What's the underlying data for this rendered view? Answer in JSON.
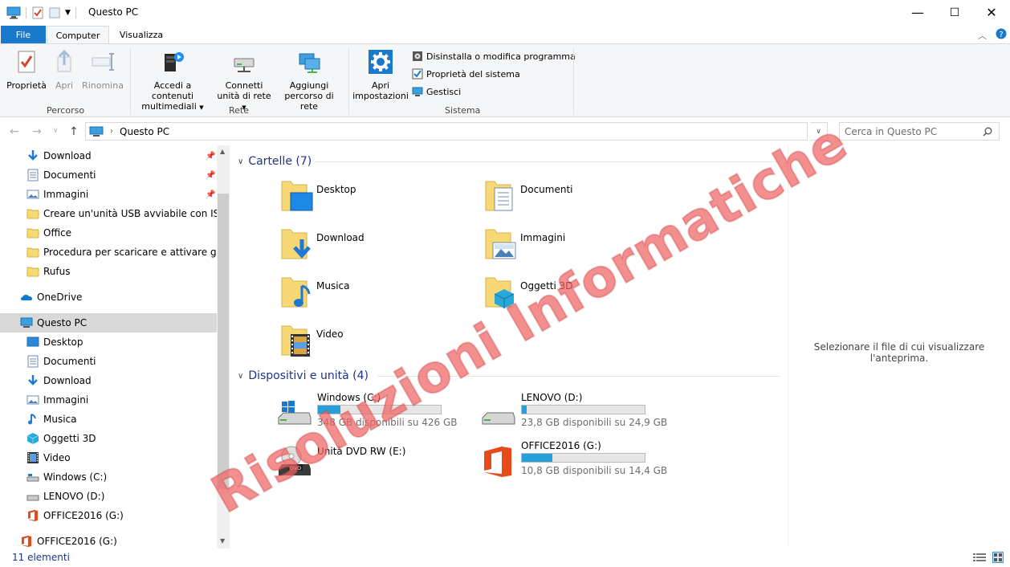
{
  "window": {
    "title": "Questo PC",
    "minimize": "—",
    "maximize": "☐",
    "close": "✕"
  },
  "ribbon_tabs": {
    "file": "File",
    "computer": "Computer",
    "view": "Visualizza"
  },
  "ribbon": {
    "percorso": {
      "label": "Percorso",
      "properties": "Proprietà",
      "open": "Apri",
      "rename": "Rinomina"
    },
    "rete": {
      "label": "Rete",
      "media_line1": "Accedi a contenuti",
      "media_line2": "multimediali",
      "map_line1": "Connetti",
      "map_line2": "unità di rete",
      "add_line1": "Aggiungi",
      "add_line2": "percorso di rete"
    },
    "sistema": {
      "label": "Sistema",
      "settings_line1": "Apri",
      "settings_line2": "impostazioni",
      "uninstall": "Disinstalla o modifica programma",
      "system_properties": "Proprietà del sistema",
      "manage": "Gestisci"
    }
  },
  "address": {
    "path": "Questo PC",
    "search_placeholder": "Cerca in Questo PC"
  },
  "nav_pane": {
    "quick_access": [
      {
        "label": "Download",
        "icon": "download-icon",
        "pinned": true
      },
      {
        "label": "Documenti",
        "icon": "documents-icon",
        "pinned": true
      },
      {
        "label": "Immagini",
        "icon": "pictures-icon",
        "pinned": true
      },
      {
        "label": "Creare un'unità USB avviabile con ISO to",
        "icon": "folder-icon",
        "pinned": false
      },
      {
        "label": "Office",
        "icon": "folder-icon",
        "pinned": false
      },
      {
        "label": "Procedura per scaricare e attivare gratuita",
        "icon": "folder-icon",
        "pinned": false
      },
      {
        "label": "Rufus",
        "icon": "folder-icon",
        "pinned": false
      }
    ],
    "onedrive": "OneDrive",
    "this_pc": "Questo PC",
    "this_pc_items": [
      {
        "label": "Desktop",
        "icon": "desktop-icon"
      },
      {
        "label": "Documenti",
        "icon": "documents-icon"
      },
      {
        "label": "Download",
        "icon": "download-icon"
      },
      {
        "label": "Immagini",
        "icon": "pictures-icon"
      },
      {
        "label": "Musica",
        "icon": "music-icon"
      },
      {
        "label": "Oggetti 3D",
        "icon": "3d-objects-icon"
      },
      {
        "label": "Video",
        "icon": "video-icon"
      },
      {
        "label": "Windows (C:)",
        "icon": "drive-icon"
      },
      {
        "label": "LENOVO (D:)",
        "icon": "drive-icon"
      },
      {
        "label": "OFFICE2016 (G:)",
        "icon": "office-icon"
      }
    ],
    "bottom_item": "OFFICE2016 (G:)"
  },
  "content": {
    "folders_header": "Cartelle (7)",
    "folders": [
      {
        "name": "Desktop",
        "icon": "desktop-folder-icon"
      },
      {
        "name": "Documenti",
        "icon": "documents-folder-icon"
      },
      {
        "name": "Download",
        "icon": "download-folder-icon"
      },
      {
        "name": "Immagini",
        "icon": "pictures-folder-icon"
      },
      {
        "name": "Musica",
        "icon": "music-folder-icon"
      },
      {
        "name": "Oggetti 3D",
        "icon": "3d-objects-folder-icon"
      },
      {
        "name": "Video",
        "icon": "video-folder-icon"
      }
    ],
    "devices_header": "Dispositivi e unità (4)",
    "drives": [
      {
        "name": "Windows (C:)",
        "free": "348 GB disponibili su 426 GB",
        "used_fraction": 0.18,
        "icon": "windows-drive-icon"
      },
      {
        "name": "LENOVO (D:)",
        "free": "23,8 GB disponibili su 24,9 GB",
        "used_fraction": 0.04,
        "icon": "drive-icon"
      },
      {
        "name": "Unità DVD RW (E:)",
        "icon": "dvd-drive-icon"
      },
      {
        "name": "OFFICE2016 (G:)",
        "free": "10,8 GB disponibili su 14,4 GB",
        "used_fraction": 0.25,
        "icon": "office-drive-icon"
      }
    ],
    "preview_text": "Selezionare il file di cui visualizzare l'anteprima."
  },
  "status": {
    "count": "11 elementi"
  },
  "watermark": "Risoluzioni Informatiche",
  "colors": {
    "accent": "#1979ca",
    "progress": "#26a0da",
    "section_header": "#1e3287",
    "folder_yellow": "#f8d775",
    "watermark": "#f06464"
  }
}
